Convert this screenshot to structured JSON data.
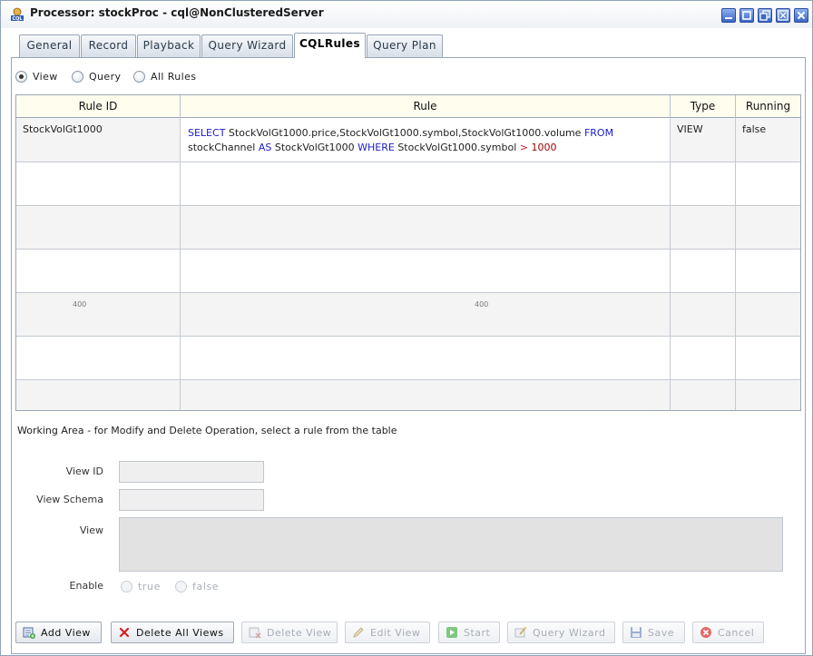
{
  "window": {
    "title": "Processor: stockProc - cql@NonClusteredServer",
    "app_icon": "cql-icon",
    "controls": [
      "minimize-icon",
      "restore-icon",
      "maximize-icon",
      "dock-icon",
      "close-icon"
    ]
  },
  "tabs": [
    {
      "label": "General",
      "active": false
    },
    {
      "label": "Record",
      "active": false
    },
    {
      "label": "Playback",
      "active": false
    },
    {
      "label": "Query Wizard",
      "active": false
    },
    {
      "label": "CQLRules",
      "active": true
    },
    {
      "label": "Query Plan",
      "active": false
    }
  ],
  "filter": {
    "options": [
      "View",
      "Query",
      "All Rules"
    ],
    "selected": "View"
  },
  "table": {
    "columns": [
      "Rule ID",
      "Rule",
      "Type",
      "Running"
    ],
    "rows": [
      {
        "rule_id": "StockVolGt1000",
        "rule": {
          "kw_select": "SELECT",
          "fields": "StockVolGt1000.price,StockVolGt1000.symbol,StockVolGt1000.volume",
          "kw_from": "FROM",
          "source": "stockChannel",
          "kw_as": "AS",
          "alias": "StockVolGt1000",
          "kw_where": "WHERE",
          "cond_field": "StockVolGt1000.symbol",
          "operator": ">",
          "value": "1000"
        },
        "type": "VIEW",
        "running": "false"
      }
    ],
    "ghost_text": "400"
  },
  "working_area": {
    "caption": "Working Area - for Modify and Delete Operation, select a rule from the table",
    "view_id_label": "View ID",
    "view_id_value": "",
    "view_schema_label": "View Schema",
    "view_schema_value": "",
    "view_label": "View",
    "view_value": "",
    "enable_label": "Enable",
    "enable_options": [
      "true",
      "false"
    ]
  },
  "buttons": [
    {
      "label": "Add View",
      "icon": "add-view-icon",
      "enabled": true
    },
    {
      "label": "Delete All Views",
      "icon": "delete-x-icon",
      "enabled": true
    },
    {
      "label": "Delete View",
      "icon": "delete-view-icon",
      "enabled": false
    },
    {
      "label": "Edit View",
      "icon": "pencil-icon",
      "enabled": false
    },
    {
      "label": "Start",
      "icon": "play-icon",
      "enabled": false
    },
    {
      "label": "Query Wizard",
      "icon": "query-wizard-icon",
      "enabled": false
    },
    {
      "label": "Save",
      "icon": "save-icon",
      "enabled": false
    },
    {
      "label": "Cancel",
      "icon": "cancel-icon",
      "enabled": false
    }
  ],
  "colors": {
    "keyword": "#1c1ccc",
    "operator": "#cc2020",
    "number": "#990000",
    "header_bg": "#fffeee",
    "title_button": "#3a66c4"
  }
}
